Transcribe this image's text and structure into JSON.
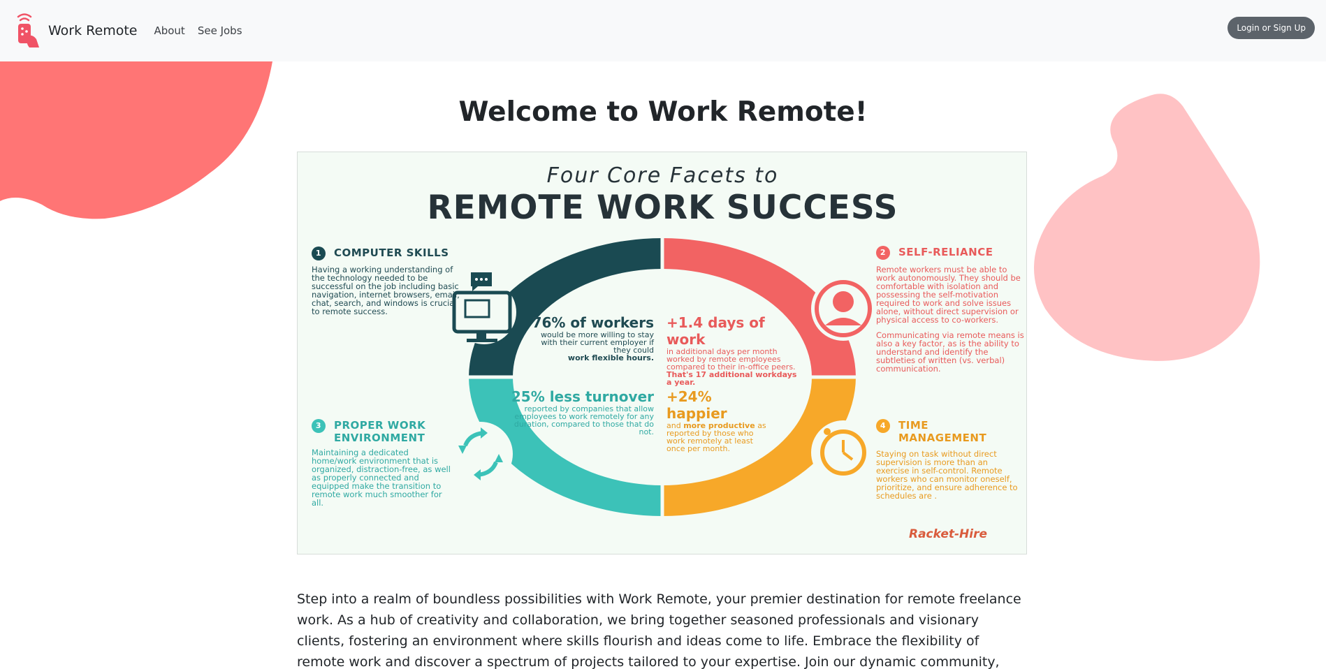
{
  "navbar": {
    "brand": "Work Remote",
    "links": [
      "About",
      "See Jobs"
    ],
    "login_label": "Login or Sign Up"
  },
  "page": {
    "title": "Welcome to Work Remote!",
    "intro": "Step into a realm of boundless possibilities with Work Remote, your premier destination for remote freelance work. As a hub of creativity and collaboration, we bring together seasoned professionals and visionary clients, fostering an environment where skills flourish and ideas come to life. Embrace the flexibility of remote work and discover a spectrum of projects tailored to your expertise. Join our dynamic community, where innovation knows no bounds."
  },
  "infographic": {
    "subtitle": "Four Core Facets to",
    "title": "REMOTE WORK SUCCESS",
    "facets": [
      {
        "number": "1",
        "title": "COMPUTER SKILLS",
        "body": "Having a working understanding of the technology needed to be successful on the job including basic navigation, internet browsers, email, chat, search, and windows is crucial to remote success."
      },
      {
        "number": "2",
        "title": "SELF-RELIANCE",
        "body": "Remote workers must be able to work autonomously. They should be comfortable with isolation and possessing the self-motivation required to work and solve issues alone, without direct supervision or physical access to co-workers.",
        "body2": "Communicating via remote means is also a key factor, as is the ability to understand and identify the subtleties of written (vs. verbal) communication."
      },
      {
        "number": "3",
        "title": "PROPER WORK ENVIRONMENT",
        "body": "Maintaining a dedicated home/work environment that is organized, distraction-free, as well as properly connected and equipped make the transition to remote work much smoother for all."
      },
      {
        "number": "4",
        "title": "TIME MANAGEMENT",
        "body": "Staying on task without direct supervision is more than an exercise in self-control. Remote workers who can monitor oneself, prioritize, and ensure adherence to schedules are ."
      }
    ],
    "stats": [
      {
        "headline": "76% of workers",
        "detail": "would be more willing to stay with their current employer if they could",
        "emphasis": "work flexible hours."
      },
      {
        "headline": "+1.4 days of work",
        "detail": "in additional days per month worked by remote employees compared to their in-office peers.",
        "emphasis": "That's 17 additional workdays a year."
      },
      {
        "headline": "25% less turnover",
        "detail": "reported by companies that allow employees to work remotely for any duration, compared to those that do not."
      },
      {
        "headline": "+24% happier",
        "detail": "and",
        "emphasis": "more productive",
        "detail2": "as reported by those who work remotely at least once per month."
      }
    ],
    "watermark": "Racket-Hire"
  },
  "colors": {
    "navbar_bg": "#f8f9fa",
    "button_bg": "#5c636a",
    "blob_left": "#ff7575",
    "blob_right": "#ffc2c4",
    "ring_dark": "#1a4a52",
    "ring_coral": "#f26363",
    "ring_teal": "#3cc2b8",
    "ring_orange": "#f7a829"
  }
}
